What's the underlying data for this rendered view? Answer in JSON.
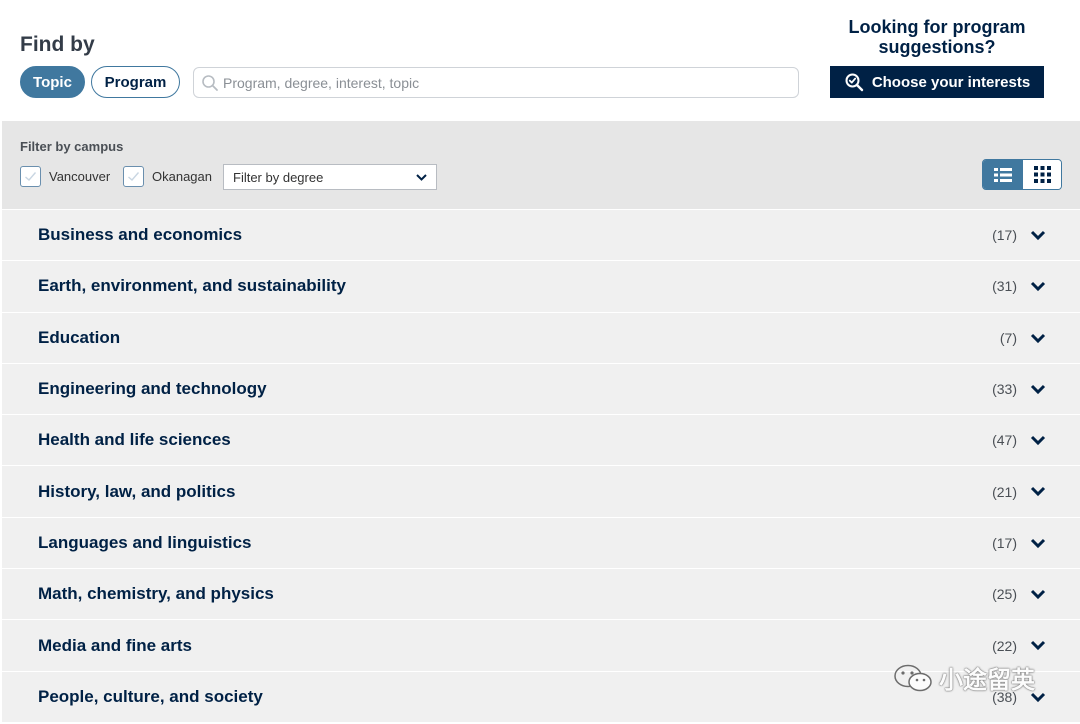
{
  "header": {
    "find_by": "Find by",
    "tabs": [
      {
        "label": "Topic",
        "active": true
      },
      {
        "label": "Program",
        "active": false
      }
    ],
    "search_placeholder": "Program, degree, interest, topic"
  },
  "suggestions": {
    "line1": "Looking for program",
    "line2": "suggestions?",
    "button_label": "Choose your interests"
  },
  "filters": {
    "label": "Filter by campus",
    "campuses": [
      {
        "label": "Vancouver",
        "checked": false
      },
      {
        "label": "Okanagan",
        "checked": false
      }
    ],
    "degree_select": "Filter by degree",
    "view_mode": "list"
  },
  "topics": [
    {
      "name": "Business and economics",
      "count": "(17)"
    },
    {
      "name": "Earth, environment, and sustainability",
      "count": "(31)"
    },
    {
      "name": "Education",
      "count": "(7)"
    },
    {
      "name": "Engineering and technology",
      "count": "(33)"
    },
    {
      "name": "Health and life sciences",
      "count": "(47)"
    },
    {
      "name": "History, law, and politics",
      "count": "(21)"
    },
    {
      "name": "Languages and linguistics",
      "count": "(17)"
    },
    {
      "name": "Math, chemistry, and physics",
      "count": "(25)"
    },
    {
      "name": "Media and fine arts",
      "count": "(22)"
    },
    {
      "name": "People, culture, and society",
      "count": "(38)"
    }
  ],
  "watermark": "小途留英",
  "colors": {
    "navy": "#002145",
    "accent": "#40789f",
    "panel": "#e6e6e6",
    "row": "#f0f0f0"
  }
}
